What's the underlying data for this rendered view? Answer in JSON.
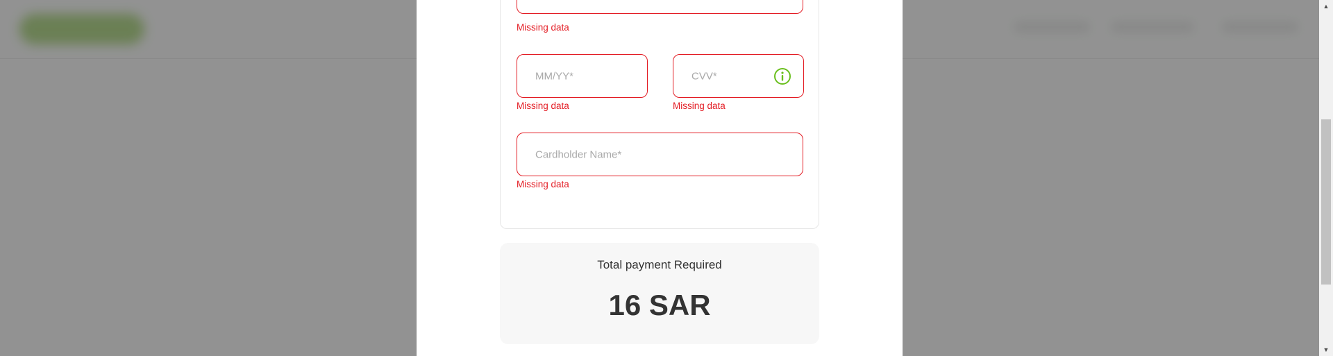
{
  "form": {
    "card_number": {
      "error": "Missing data"
    },
    "expiry": {
      "placeholder": "MM/YY*",
      "error": "Missing data"
    },
    "cvv": {
      "placeholder": "CVV*",
      "error": "Missing data",
      "icon": "info-icon"
    },
    "cardholder": {
      "placeholder": "Cardholder Name*",
      "error": "Missing data"
    }
  },
  "summary": {
    "label": "Total payment Required",
    "amount": "16 SAR"
  },
  "colors": {
    "error": "#e31b23",
    "accent": "#6abf1e",
    "text": "#333333",
    "placeholder": "#a9a9a9"
  },
  "scrollbar": {
    "up_icon": "▲",
    "down_icon": "▼"
  }
}
